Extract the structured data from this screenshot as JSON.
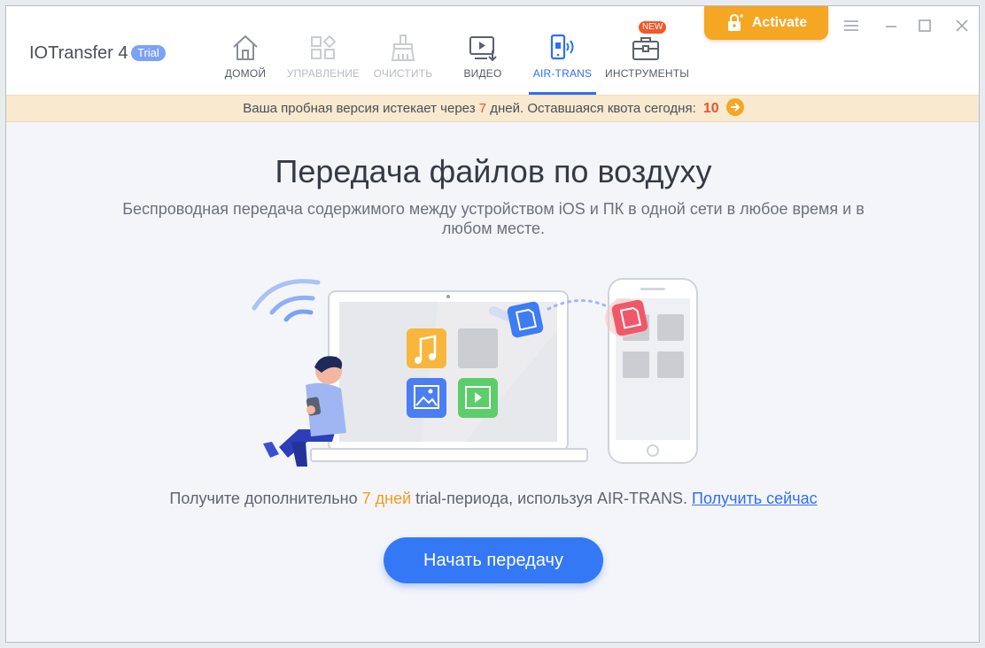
{
  "app": {
    "name": "IOTransfer 4",
    "trial_badge": "Trial",
    "new_badge": "NEW",
    "activate_label": "Activate"
  },
  "nav": [
    {
      "label": "ДОМОЙ",
      "icon": "home-icon",
      "state": "normal"
    },
    {
      "label": "УПРАВЛЕНИЕ",
      "icon": "grid-icon",
      "state": "disabled"
    },
    {
      "label": "ОЧИСТИТЬ",
      "icon": "broom-icon",
      "state": "disabled"
    },
    {
      "label": "ВИДЕО",
      "icon": "video-download-icon",
      "state": "normal"
    },
    {
      "label": "AIR-TRANS",
      "icon": "phone-wireless-icon",
      "state": "active"
    },
    {
      "label": "ИНСТРУМЕНТЫ",
      "icon": "toolbox-icon",
      "state": "normal"
    }
  ],
  "banner": {
    "text_before": "Ваша пробная версия истекает через ",
    "days": "7",
    "text_after": " дней. Оставшаяся квота сегодня: ",
    "quota": "10"
  },
  "main": {
    "title": "Передача файлов по воздуху",
    "subtitle": "Беспроводная передача содержимого между устройством iOS и ПК в одной сети в любое время и в любом месте."
  },
  "trial_offer": {
    "text_before": "Получите дополнительно ",
    "days": "7 дней",
    "text_after": " trial-периода, используя AIR-TRANS. ",
    "link": "Получить сейчас"
  },
  "start_button": "Начать передачу",
  "colors": {
    "accent": "#3478f6",
    "activate": "#f5a623",
    "highlight": "#e4572e",
    "banner_bg": "#f8e9cf"
  }
}
